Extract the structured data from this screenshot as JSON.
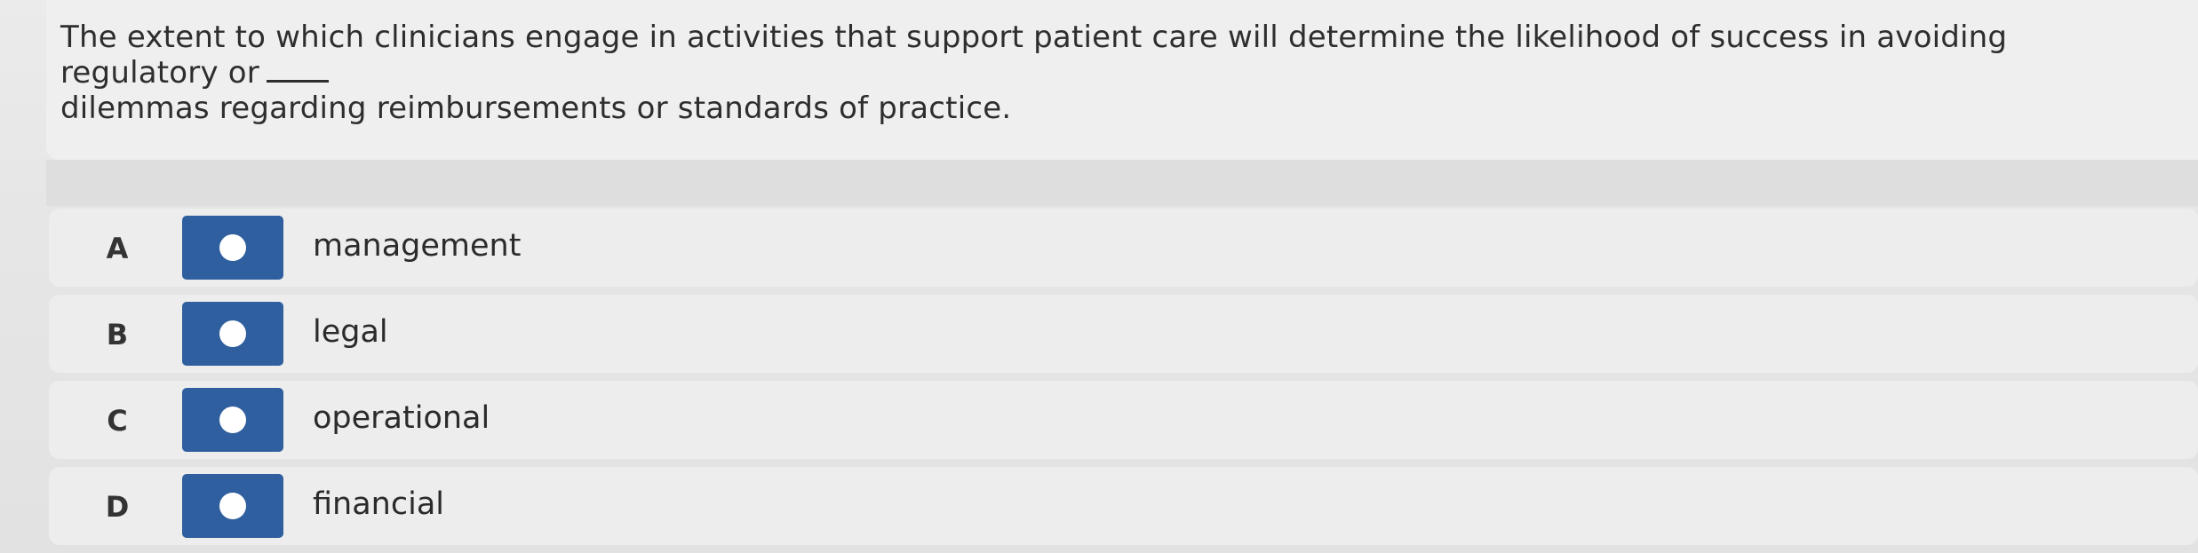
{
  "question": {
    "text": "The extent to which clinicians engage in activities that support patient care will determine the likelihood of success in avoiding regulatory or",
    "text_continued": "dilemmas regarding reimbursements or standards of practice."
  },
  "options": [
    {
      "letter": "A",
      "label": "management",
      "selected": false
    },
    {
      "letter": "B",
      "label": "legal",
      "selected": false
    },
    {
      "letter": "C",
      "label": "operational",
      "selected": false
    },
    {
      "letter": "D",
      "label": "financial",
      "selected": false
    }
  ],
  "colors": {
    "radio_button": "#2f5f9e",
    "radio_dot": "#ffffff",
    "background": "#e4e4e4",
    "option_row": "#ededed"
  },
  "icons": {
    "radio": "radio-circle-icon"
  }
}
